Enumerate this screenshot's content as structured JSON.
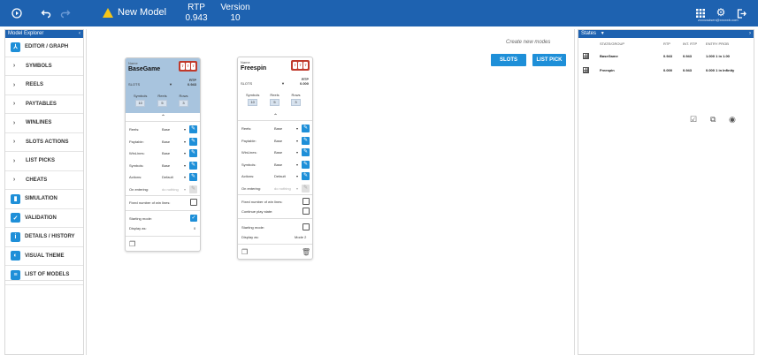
{
  "topbar": {
    "title": "New Model",
    "rtp_label": "RTP",
    "rtp_value": "0.943",
    "version_label": "Version",
    "version_value": "10",
    "user_email": "zxxxcsdsen@xxcxxb.com"
  },
  "explorer": {
    "title": "Model Explorer",
    "items": [
      {
        "label": "EDITOR / GRAPH",
        "icon": "graph-icon",
        "type": "icon"
      },
      {
        "label": "SYMBOLS",
        "icon": "chevron-right-icon",
        "type": "arrow"
      },
      {
        "label": "REELS",
        "icon": "chevron-right-icon",
        "type": "arrow"
      },
      {
        "label": "PAYTABLES",
        "icon": "chevron-right-icon",
        "type": "arrow"
      },
      {
        "label": "WINLINES",
        "icon": "chevron-right-icon",
        "type": "arrow"
      },
      {
        "label": "SLOTS ACTIONS",
        "icon": "chevron-right-icon",
        "type": "arrow"
      },
      {
        "label": "LIST PICKS",
        "icon": "chevron-right-icon",
        "type": "arrow"
      },
      {
        "label": "CHEATS",
        "icon": "chevron-right-icon",
        "type": "arrow"
      },
      {
        "label": "SIMULATION",
        "icon": "bar-chart-icon",
        "type": "icon"
      },
      {
        "label": "VALIDATION",
        "icon": "checkbox-icon",
        "type": "icon"
      },
      {
        "label": "DETAILS / HISTORY",
        "icon": "info-icon",
        "type": "icon"
      },
      {
        "label": "VISUAL THEME",
        "icon": "palette-icon",
        "type": "icon"
      },
      {
        "label": "LIST OF MODELS",
        "icon": "list-icon",
        "type": "icon"
      }
    ]
  },
  "canvas": {
    "create_label": "Create new modes",
    "slots_button": "SLOTS",
    "listpick_button": "LIST PICK"
  },
  "cards": [
    {
      "name_label": "Name",
      "name": "BaseGame",
      "type": "SLOTS",
      "rtp_label": "RTP",
      "rtp": "0.943",
      "symbols_label": "Symbols",
      "symbols": "10",
      "reels_label": "Reels",
      "reels": "5",
      "rows_label": "Rows",
      "rows": "3",
      "fields": [
        {
          "label": "Reels:",
          "value": "Base"
        },
        {
          "label": "Paytable:",
          "value": "Base"
        },
        {
          "label": "WinLines:",
          "value": "Base"
        },
        {
          "label": "Symbols:",
          "value": "Base"
        },
        {
          "label": "Actions:",
          "value": "Default"
        },
        {
          "label": "On entering:",
          "value": "do nothing"
        }
      ],
      "fixed_winlines": "Fixed number of win lines:",
      "starting_mode": "Starting mode:",
      "display_as": "Display as:",
      "display_value": "0"
    },
    {
      "name_label": "Name",
      "name": "Freespin",
      "type": "SLOTS",
      "rtp_label": "RTP",
      "rtp": "0.000",
      "symbols_label": "Symbols",
      "symbols": "10",
      "reels_label": "Reels",
      "reels": "5",
      "rows_label": "Rows",
      "rows": "3",
      "fields": [
        {
          "label": "Reels:",
          "value": "Base"
        },
        {
          "label": "Paytable:",
          "value": "Base"
        },
        {
          "label": "WinLines:",
          "value": "Base"
        },
        {
          "label": "Symbols:",
          "value": "Base"
        },
        {
          "label": "Actions:",
          "value": "Default"
        },
        {
          "label": "On entering:",
          "value": "do nothing"
        }
      ],
      "fixed_winlines": "Fixed number of win lines:",
      "continue_play": "Continue play state:",
      "starting_mode": "Starting mode:",
      "display_as": "Display as:",
      "display_value": "Mode 2"
    }
  ],
  "states": {
    "title": "States",
    "columns": [
      "STATE/GROUP",
      "RTP",
      "INT. RTP",
      "ENTRY PROB"
    ],
    "rows": [
      {
        "name": "BaseGame",
        "rtp": "0.943",
        "int_rtp": "0.943",
        "entry_prob": "1.000 1 in 1.00"
      },
      {
        "name": "Freespin",
        "rtp": "0.000",
        "int_rtp": "0.943",
        "entry_prob": "0.000 1 in Infinity"
      }
    ]
  },
  "colors": {
    "brand": "#1e62b0",
    "accent": "#1e8fd8",
    "selected_card": "#a8c4de"
  }
}
